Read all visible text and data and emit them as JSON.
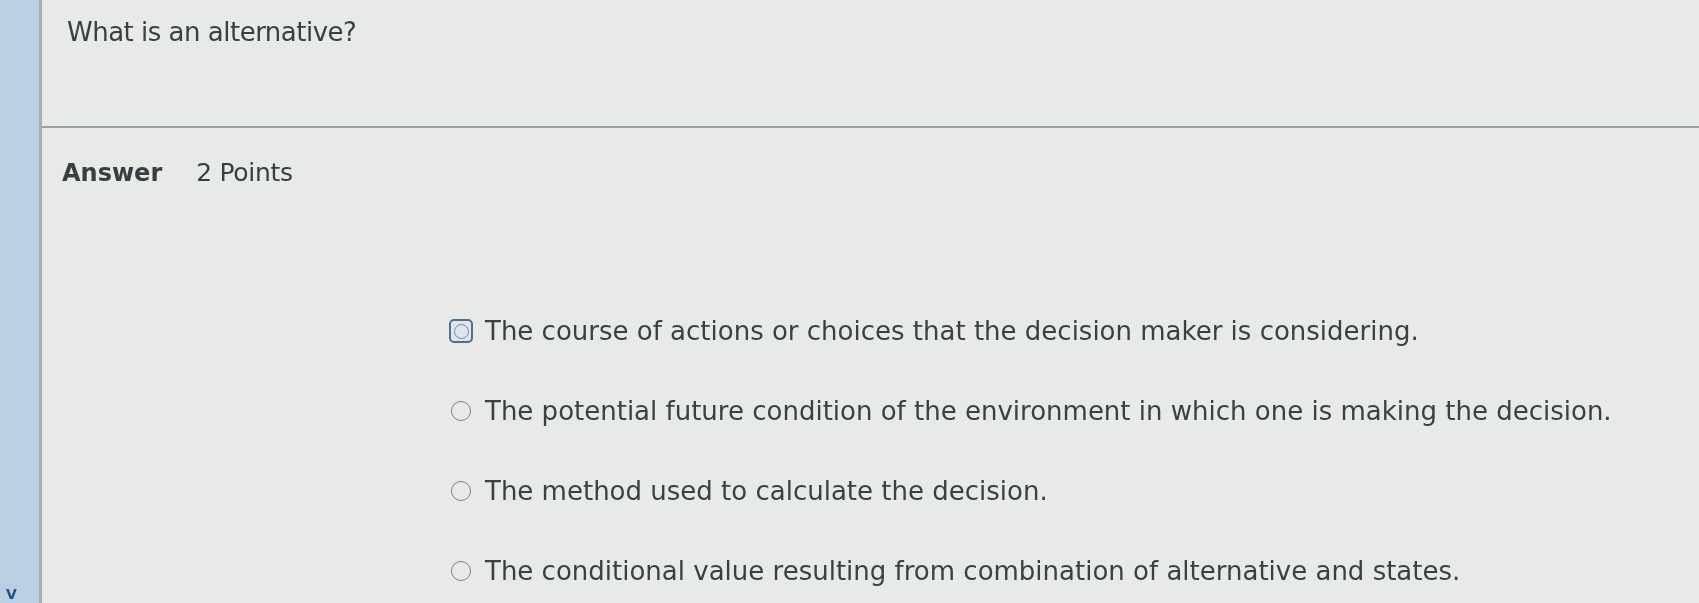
{
  "sidebar": {
    "label": "V"
  },
  "question": {
    "text": "What is an alternative?"
  },
  "answer": {
    "label": "Answer",
    "points": "2 Points"
  },
  "options": [
    {
      "text": "The course of actions or choices that the decision maker is considering.",
      "selected": false,
      "focused": true
    },
    {
      "text": "The potential future condition of the environment in which one is making the decision.",
      "selected": false,
      "focused": false
    },
    {
      "text": "The method used to calculate the decision.",
      "selected": false,
      "focused": false
    },
    {
      "text": "The conditional value resulting from combination of alternative and states.",
      "selected": false,
      "focused": false
    }
  ]
}
